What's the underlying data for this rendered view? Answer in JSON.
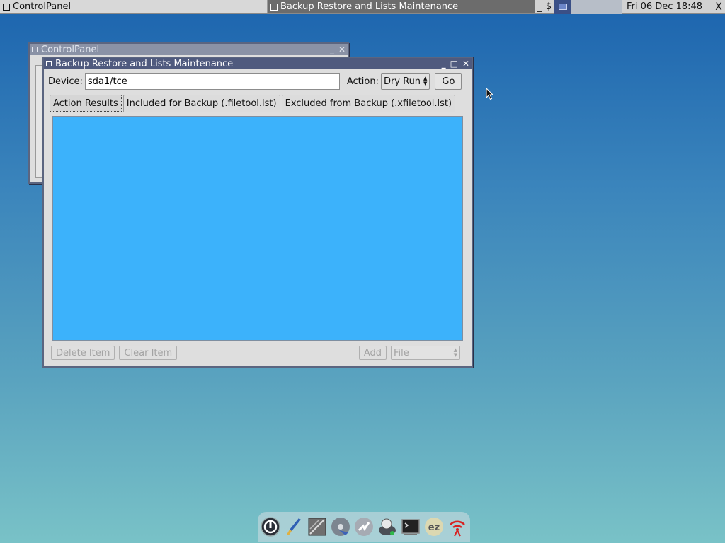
{
  "taskbar": {
    "tasks": [
      {
        "label": "ControlPanel",
        "active": false
      },
      {
        "label": "Backup Restore and Lists Maintenance",
        "active": true
      }
    ],
    "tray_min": "_",
    "tray_dollar": "$",
    "clock": "Fri 06 Dec 18:48",
    "close_glyph": "X"
  },
  "bg_window": {
    "title": "ControlPanel"
  },
  "window": {
    "title": "Backup Restore and Lists Maintenance",
    "device_label": "Device:",
    "device_value": "sda1/tce",
    "action_label": "Action:",
    "action_value": "Dry Run",
    "go_label": "Go",
    "tabs": [
      {
        "label": "Action Results",
        "active": true
      },
      {
        "label": "Included for Backup (.filetool.lst)",
        "active": false
      },
      {
        "label": "Excluded from Backup (.xfiletool.lst)",
        "active": false
      }
    ],
    "results_color": "#3cb2fb",
    "delete_label": "Delete Item",
    "clear_label": "Clear Item",
    "add_label": "Add",
    "add_type": "File"
  },
  "dock": {
    "icons": [
      "power-icon",
      "brush-icon",
      "image-icon",
      "disk-icon",
      "apps-icon",
      "control-panel-icon",
      "terminal-icon",
      "ez-remaster-icon",
      "wifi-icon"
    ],
    "ez_text": "ez"
  }
}
